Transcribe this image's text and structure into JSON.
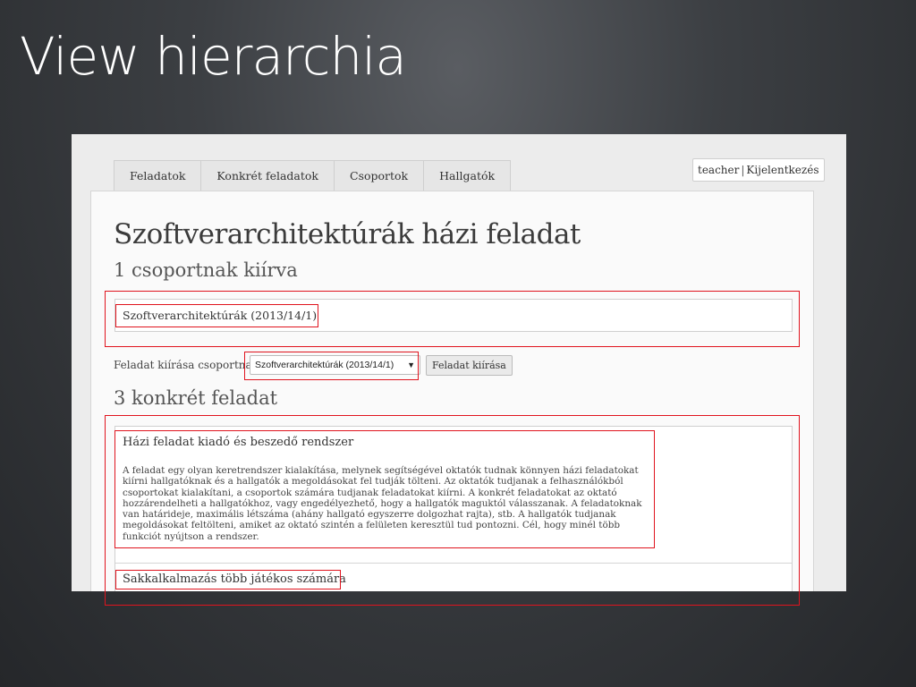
{
  "slide": {
    "title": "View hierarchia"
  },
  "nav": {
    "tabs": [
      {
        "label": "Feladatok"
      },
      {
        "label": "Konkrét feladatok"
      },
      {
        "label": "Csoportok"
      },
      {
        "label": "Hallgatók"
      }
    ],
    "user": "teacher",
    "separator": "|",
    "logout": "Kijelentkezés"
  },
  "page": {
    "title": "Szoftverarchitektúrák házi feladat",
    "assigned_heading": "1 csoportnak kiírva",
    "groups": [
      {
        "name": "Szoftverarchitektúrák (2013/14/1)"
      }
    ],
    "assign": {
      "label": "Feladat kiírása csoportnak",
      "selected": "Szoftverarchitektúrák (2013/14/1)",
      "arrow": "▼",
      "button": "Feladat kiírása"
    },
    "tasks_heading": "3 konkrét feladat",
    "tasks": [
      {
        "title": "Házi feladat kiadó és beszedő rendszer",
        "description": "A feladat egy olyan keretrendszer kialakítása, melynek segítségével oktatók tudnak könnyen házi feladatokat kiírni hallgatóknak és a hallgatók a megoldásokat fel tudják tölteni. Az oktatók tudjanak a felhasználókból csoportokat kialakítani, a csoportok számára tudjanak feladatokat kiírni. A konkrét feladatokat az oktató hozzárendelheti a hallgatókhoz, vagy engedélyezhető, hogy a hallgatók maguktól válasszanak. A feladatoknak van határideje, maximális létszáma (ahány hallgató egyszerre dolgozhat rajta), stb. A hallgatók tudjanak megoldásokat feltölteni, amiket az oktató szintén a felületen keresztül tud pontozni. Cél, hogy minél több funkciót nyújtson a rendszer."
      },
      {
        "title": "Sakkalkalmazás több játékos számára"
      }
    ]
  },
  "colors": {
    "highlight": "#e0141e",
    "slide_bg": "#3c3f43"
  }
}
